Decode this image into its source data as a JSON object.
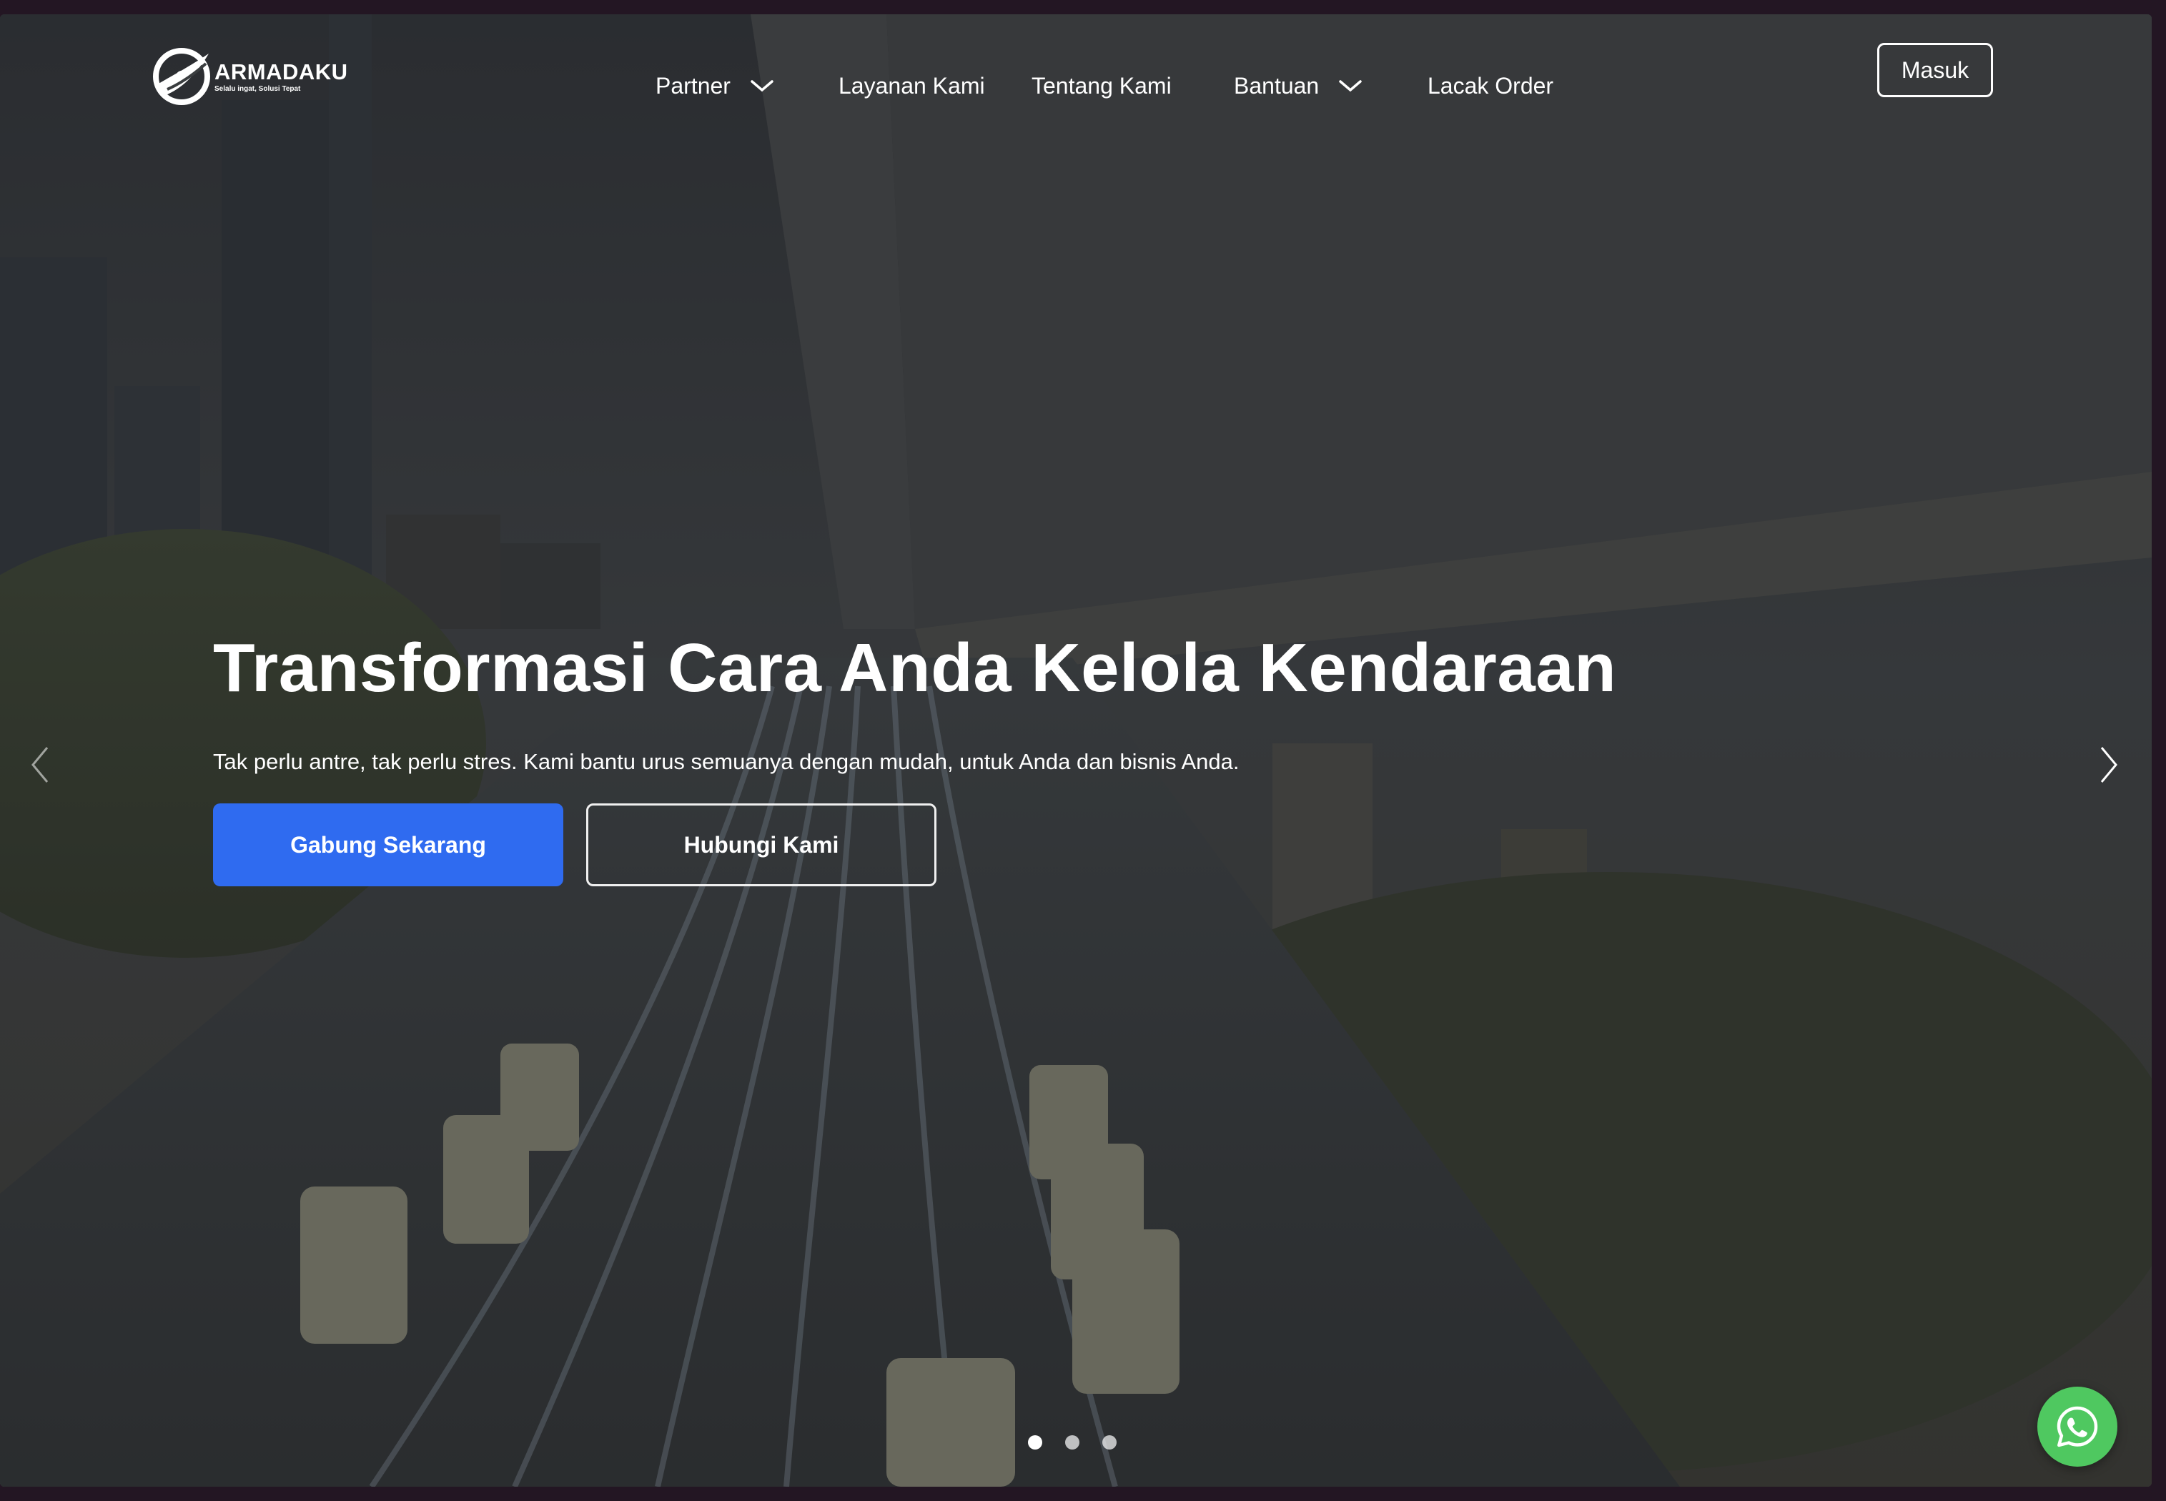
{
  "brand": {
    "name": "ARMADAKU",
    "tagline": "Selalu ingat, Solusi Tepat"
  },
  "nav": {
    "items": [
      {
        "label": "Partner",
        "has_dropdown": true
      },
      {
        "label": "Layanan Kami",
        "has_dropdown": false
      },
      {
        "label": "Tentang Kami",
        "has_dropdown": false
      },
      {
        "label": "Bantuan",
        "has_dropdown": true
      },
      {
        "label": "Lacak Order",
        "has_dropdown": false
      }
    ],
    "login_label": "Masuk"
  },
  "hero": {
    "title": "Transformasi Cara Anda Kelola Kendaraan",
    "subtitle": "Tak perlu antre, tak perlu stres. Kami bantu urus semuanya dengan mudah, untuk Anda dan bisnis Anda.",
    "primary_cta": "Gabung Sekarang",
    "secondary_cta": "Hubungi Kami"
  },
  "carousel": {
    "slide_count": 3,
    "active_index": 0
  },
  "icons": {
    "prev": "chevron-left-icon",
    "next": "chevron-right-icon",
    "dropdown": "chevron-down-icon",
    "whatsapp": "whatsapp-icon"
  },
  "colors": {
    "primary": "#2f6bf0",
    "whatsapp": "#4fc860",
    "text": "#ffffff"
  }
}
